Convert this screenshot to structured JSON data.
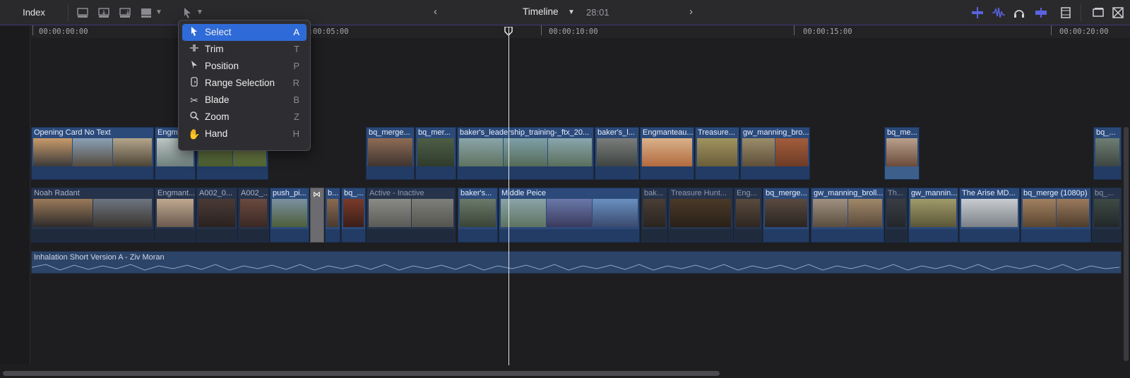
{
  "toolbar": {
    "index_label": "Index",
    "timeline_title": "Timeline",
    "duration": "28:01",
    "prev_icon": "chevron-left-icon",
    "next_icon": "chevron-right-icon",
    "accent_color": "#5a63e0"
  },
  "ruler": {
    "labels": [
      "00:00:00:00",
      "00:00:05:00",
      "00:00:10:00",
      "00:00:15:00",
      "00:00:20:00"
    ]
  },
  "tool_menu": {
    "items": [
      {
        "label": "Select",
        "key": "A",
        "icon": "arrow-icon",
        "selected": true
      },
      {
        "label": "Trim",
        "key": "T",
        "icon": "trim-icon",
        "selected": false
      },
      {
        "label": "Position",
        "key": "P",
        "icon": "position-icon",
        "selected": false
      },
      {
        "label": "Range Selection",
        "key": "R",
        "icon": "range-selection-icon",
        "selected": false
      },
      {
        "label": "Blade",
        "key": "B",
        "icon": "scissors-icon",
        "selected": false
      },
      {
        "label": "Zoom",
        "key": "Z",
        "icon": "magnifier-icon",
        "selected": false
      },
      {
        "label": "Hand",
        "key": "H",
        "icon": "hand-icon",
        "selected": false
      }
    ]
  },
  "tracks": {
    "upper": [
      "Opening Card No Text",
      "Engmant...",
      "bq_merge...",
      "bq_mer...",
      "baker's_leadership_training-_ftx_20...",
      "baker's_l...",
      "Engmanteau...",
      "Treasure...",
      "gw_manning_bro...",
      "bq_me...",
      "bq_..."
    ],
    "lower": [
      "Noah Radant",
      "Engmant...",
      "A002_0...",
      "A002_...",
      "push_pi...",
      "b...",
      "bq_...",
      "Active - Inactive",
      "baker's...",
      "Middle Peice",
      "bak...",
      "Treasure Hunt...",
      "Eng...",
      "bq_merge...",
      "gw_manning_broll...",
      "Th...",
      "gw_mannin...",
      "The Arise MD...",
      "bq_merge (1080p)",
      "bq_..."
    ],
    "audio": "Inhalation  Short Version A - Ziv Moran"
  }
}
